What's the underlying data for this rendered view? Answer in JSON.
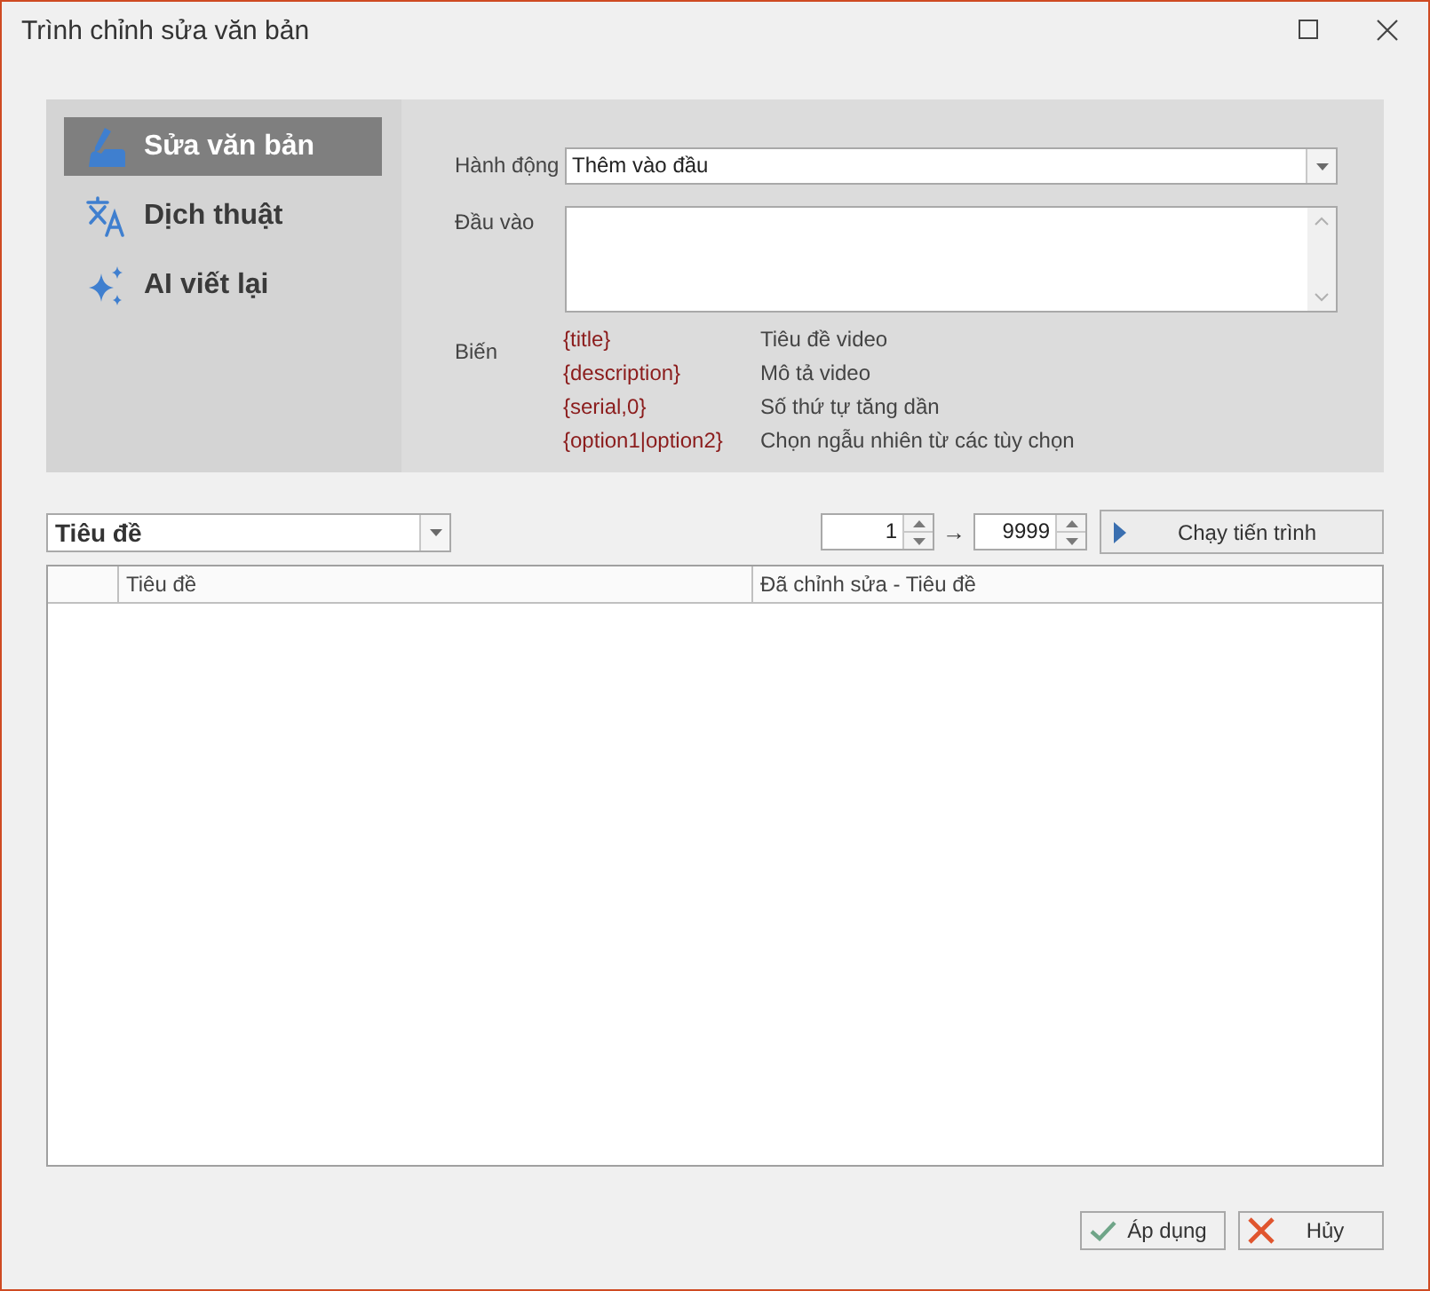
{
  "window": {
    "title": "Trình chỉnh sửa văn bản"
  },
  "sidebar": {
    "items": [
      {
        "label": "Sửa văn bản",
        "selected": true
      },
      {
        "label": "Dịch thuật",
        "selected": false
      },
      {
        "label": "AI viết lại",
        "selected": false
      }
    ]
  },
  "form": {
    "action": {
      "label": "Hành động",
      "value": "Thêm vào đầu"
    },
    "input": {
      "label": "Đầu vào"
    },
    "variables": {
      "label": "Biến",
      "items": [
        {
          "token": "{title}",
          "description": "Tiêu đề video"
        },
        {
          "token": "{description}",
          "description": "Mô tả video"
        },
        {
          "token": "{serial,0}",
          "description": "Số thứ tự tăng dần"
        },
        {
          "token": "{option1|option2}",
          "description": "Chọn ngẫu nhiên từ các tùy chọn"
        }
      ]
    }
  },
  "toolbar": {
    "field": {
      "value": "Tiêu đề"
    },
    "range_from": "1",
    "range_separator": "→",
    "range_to": "9999",
    "run_button": "Chạy tiến trình"
  },
  "table": {
    "columns": [
      "Tiêu đề",
      "Đã chỉnh sửa - Tiêu đề"
    ]
  },
  "buttons": [
    {
      "label": "Áp dụng",
      "kind": "apply"
    },
    {
      "label": "Hủy",
      "kind": "cancel"
    }
  ]
}
